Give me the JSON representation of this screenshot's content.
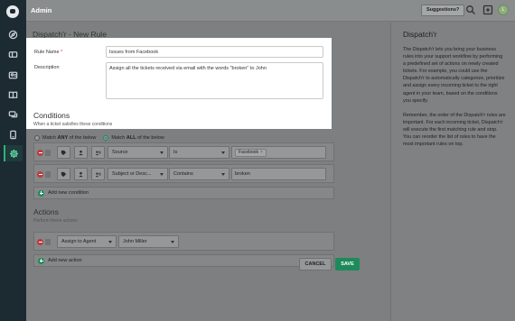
{
  "topbar": {
    "title": "Admin",
    "suggestions_label": "Suggestions?",
    "avatar_initial": "L"
  },
  "page": {
    "title": "Dispatch'r - New Rule"
  },
  "form": {
    "rule_name_label": "Rule Name",
    "required_mark": "*",
    "rule_name_value": "Issues from Facebook",
    "description_label": "Description",
    "description_value": "Assign all the tickets received via email with the words \"broken\" to John"
  },
  "conditions": {
    "title": "Conditions",
    "subtitle": "When a ticket satisfies these conditions",
    "match_any_prefix": "Match",
    "match_any_strong": "ANY",
    "match_any_suffix": "of the below",
    "match_all_prefix": "Match",
    "match_all_strong": "ALL",
    "match_all_suffix": "of the below",
    "selected_match": "ALL",
    "rows": [
      {
        "field": "Source",
        "operator": "Is",
        "value_tag": "Facebook",
        "value_tag_remove": "×"
      },
      {
        "field": "Subject or Desc...",
        "operator": "Contains",
        "value_text": "broken"
      }
    ],
    "add_label": "Add new condition"
  },
  "actions": {
    "title": "Actions",
    "subtitle": "Perform these actions",
    "rows": [
      {
        "action": "Assign to Agent",
        "value": "John Miller"
      }
    ],
    "add_label": "Add new action"
  },
  "buttons": {
    "cancel": "CANCEL",
    "save": "SAVE"
  },
  "help": {
    "title": "Dispatch'r",
    "para1": "The Dispatch'r lets you bring your business rules into your support workflow by performing a predefined set of actions on newly created tickets. For example, you could use the Dispatch'r to automatically categorize, prioritize and assign every incoming ticket to the right agent in your team, based on the conditions you specify.",
    "para2": "Remember, the order of the Dispatch'r rules are important. For each incoming ticket, Dispatch'r will execute the first matching rule and stop. You can reorder the list of rules to have the most important rules on top."
  },
  "colors": {
    "accent": "#1e8a5a",
    "sidebar": "#1c2a32",
    "danger": "#b83c3c",
    "overlay_bg": "#858788"
  },
  "icons": {
    "sidebar": [
      "logo-icon",
      "compass-icon",
      "ticket-icon",
      "contacts-icon",
      "book-icon",
      "chat-icon",
      "phone-icon",
      "gear-icon"
    ],
    "topbar": [
      "search-icon",
      "new-item-icon",
      "avatar"
    ]
  }
}
